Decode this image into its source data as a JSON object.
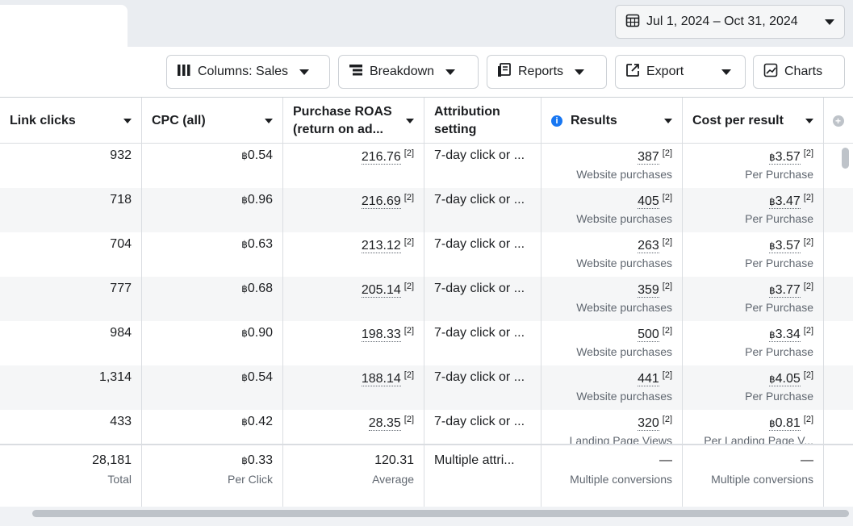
{
  "date_range": "Jul 1, 2024 – Oct 31, 2024",
  "toolbar": {
    "columns": "Columns: Sales",
    "breakdown": "Breakdown",
    "reports": "Reports",
    "export": "Export",
    "charts": "Charts"
  },
  "headers": {
    "link_clicks": "Link clicks",
    "cpc": "CPC (all)",
    "roas_1": "Purchase ROAS",
    "roas_2": "(return on ad...",
    "attr_1": "Attribution",
    "attr_2": "setting",
    "results": "Results",
    "cost": "Cost per result"
  },
  "currency": "฿",
  "ref": "[2]",
  "rows": [
    {
      "clicks": "932",
      "cpc": "0.54",
      "roas": "216.76",
      "attr": "7-day click or ...",
      "results": "387",
      "results_sub": "Website purchases",
      "cost": "3.57",
      "cost_sub": "Per Purchase"
    },
    {
      "clicks": "718",
      "cpc": "0.96",
      "roas": "216.69",
      "attr": "7-day click or ...",
      "results": "405",
      "results_sub": "Website purchases",
      "cost": "3.47",
      "cost_sub": "Per Purchase"
    },
    {
      "clicks": "704",
      "cpc": "0.63",
      "roas": "213.12",
      "attr": "7-day click or ...",
      "results": "263",
      "results_sub": "Website purchases",
      "cost": "3.57",
      "cost_sub": "Per Purchase"
    },
    {
      "clicks": "777",
      "cpc": "0.68",
      "roas": "205.14",
      "attr": "7-day click or ...",
      "results": "359",
      "results_sub": "Website purchases",
      "cost": "3.77",
      "cost_sub": "Per Purchase"
    },
    {
      "clicks": "984",
      "cpc": "0.90",
      "roas": "198.33",
      "attr": "7-day click or ...",
      "results": "500",
      "results_sub": "Website purchases",
      "cost": "3.34",
      "cost_sub": "Per Purchase"
    },
    {
      "clicks": "1,314",
      "cpc": "0.54",
      "roas": "188.14",
      "attr": "7-day click or ...",
      "results": "441",
      "results_sub": "Website purchases",
      "cost": "4.05",
      "cost_sub": "Per Purchase"
    },
    {
      "clicks": "433",
      "cpc": "0.42",
      "roas": "28.35",
      "attr": "7-day click or ...",
      "results": "320",
      "results_sub": "Landing Page Views",
      "cost": "0.81",
      "cost_sub": "Per Landing Page V..."
    }
  ],
  "totals": {
    "clicks": "28,181",
    "clicks_sub": "Total",
    "cpc": "0.33",
    "cpc_sub": "Per Click",
    "roas": "120.31",
    "roas_sub": "Average",
    "attr": "Multiple attri...",
    "results": "—",
    "results_sub": "Multiple conversions",
    "cost": "—",
    "cost_sub": "Multiple conversions"
  }
}
